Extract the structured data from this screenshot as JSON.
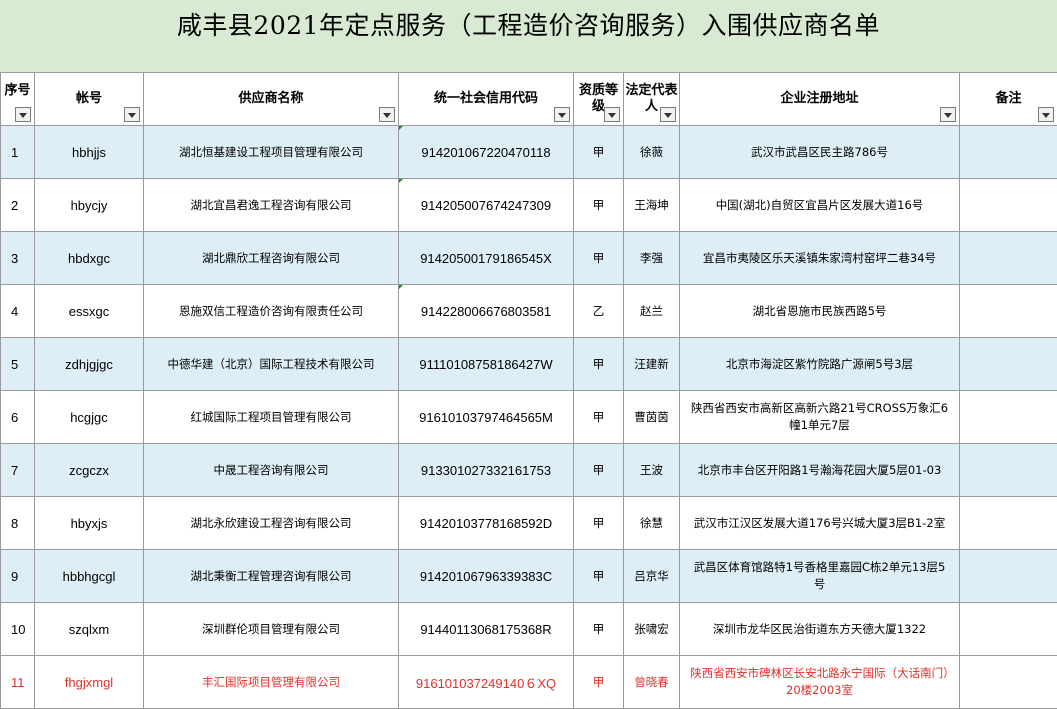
{
  "title": "咸丰县2021年定点服务（工程造价咨询服务）入围供应商名单",
  "headers": {
    "idx": "序号",
    "account": "帐号",
    "name": "供应商名称",
    "code": "统一社会信用代码",
    "grade": "资质等级",
    "rep": "法定代表人",
    "address": "企业注册地址",
    "note": "备注"
  },
  "rows": [
    {
      "idx": "1",
      "account": "hbhjjs",
      "name": "湖北恒基建设工程项目管理有限公司",
      "code": "914201067220470118",
      "grade": "甲",
      "rep": "徐薇",
      "address": "武汉市武昌区民主路786号",
      "note": ""
    },
    {
      "idx": "2",
      "account": "hbycjy",
      "name": "湖北宜昌君逸工程咨询有限公司",
      "code": "914205007674247309",
      "grade": "甲",
      "rep": "王海坤",
      "address": "中国(湖北)自贸区宜昌片区发展大道16号",
      "note": ""
    },
    {
      "idx": "3",
      "account": "hbdxgc",
      "name": "湖北鼎欣工程咨询有限公司",
      "code": "91420500179186545X",
      "grade": "甲",
      "rep": "李强",
      "address": "宜昌市夷陵区乐天溪镇朱家湾村窑坪二巷34号",
      "note": ""
    },
    {
      "idx": "4",
      "account": "essxgc",
      "name": "恩施双信工程造价咨询有限责任公司",
      "code": "914228006676803581",
      "grade": "乙",
      "rep": "赵兰",
      "address": "湖北省恩施市民族西路5号",
      "note": ""
    },
    {
      "idx": "5",
      "account": "zdhjgjgc",
      "name": "中德华建（北京）国际工程技术有限公司",
      "code": "91110108758186427W",
      "grade": "甲",
      "rep": "汪建新",
      "address": "北京市海淀区紫竹院路广源闸5号3层",
      "note": ""
    },
    {
      "idx": "6",
      "account": "hcgjgc",
      "name": "红城国际工程项目管理有限公司",
      "code": "91610103797464565M",
      "grade": "甲",
      "rep": "曹茵茵",
      "address": "陕西省西安市高新区高新六路21号CROSS万象汇6幢1单元7层",
      "note": ""
    },
    {
      "idx": "7",
      "account": "zcgczx",
      "name": "中晟工程咨询有限公司",
      "code": "913301027332161753",
      "grade": "甲",
      "rep": "王波",
      "address": "北京市丰台区开阳路1号瀚海花园大厦5层01-03",
      "note": ""
    },
    {
      "idx": "8",
      "account": "hbyxjs",
      "name": "湖北永欣建设工程咨询有限公司",
      "code": "91420103778168592D",
      "grade": "甲",
      "rep": "徐慧",
      "address": "武汉市江汉区发展大道176号兴城大厦3层B1-2室",
      "note": ""
    },
    {
      "idx": "9",
      "account": "hbbhgcgl",
      "name": "湖北秉衡工程管理咨询有限公司",
      "code": "91420106796339383C",
      "grade": "甲",
      "rep": "吕京华",
      "address": "武昌区体育馆路特1号香格里嘉园C栋2单元13层5号",
      "note": ""
    },
    {
      "idx": "10",
      "account": "szqlxm",
      "name": "深圳群伦项目管理有限公司",
      "code": "91440113068175368R",
      "grade": "甲",
      "rep": "张啸宏",
      "address": "深圳市龙华区民治街道东方天德大厦1322",
      "note": ""
    },
    {
      "idx": "11",
      "account": "fhgjxmgl",
      "name": "丰汇国际项目管理有限公司",
      "code": "916101037249140６XQ",
      "grade": "甲",
      "rep": "曾晓春",
      "address": "陕西省西安市碑林区长安北路永宁国际（大话南门）20楼2003室",
      "note": ""
    }
  ],
  "colors": {
    "title_bg": "#d9ead3",
    "alt_row": "#deeef6",
    "highlight_text": "#e0302a",
    "grid": "#9a9a9a"
  },
  "icons": {
    "filter": "dropdown-filter-icon"
  }
}
